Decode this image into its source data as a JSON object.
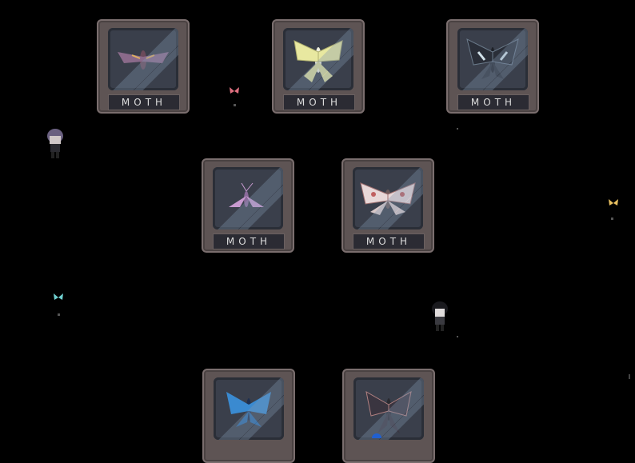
{
  "specimens": [
    {
      "label": "MOTH",
      "icon": "hawk-moth-icon"
    },
    {
      "label": "MOTH",
      "icon": "luna-moth-icon"
    },
    {
      "label": "MOTH",
      "icon": "swallowtail-moth-icon"
    },
    {
      "label": "MOTH",
      "icon": "pink-moth-icon"
    },
    {
      "label": "MOTH",
      "icon": "atlas-moth-icon"
    },
    {
      "label": "",
      "icon": "blue-butterfly-icon"
    },
    {
      "label": "",
      "icon": "dark-swallowtail-icon"
    }
  ],
  "colors": {
    "background": "#000000",
    "frame": "#5e5454",
    "glass": "#3a3f4b",
    "plate": "#2b2b33"
  },
  "characters": [
    {
      "icon": "purple-haired-player-icon"
    },
    {
      "icon": "dark-haired-npc-icon"
    }
  ],
  "ambient": [
    {
      "icon": "red-butterfly-icon"
    },
    {
      "icon": "yellow-butterfly-icon"
    },
    {
      "icon": "cyan-butterfly-icon"
    }
  ]
}
